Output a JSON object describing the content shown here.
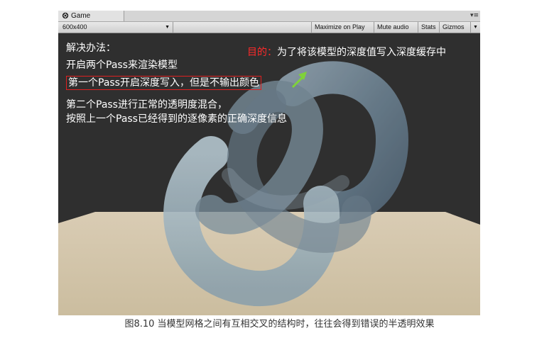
{
  "window": {
    "tab_title": "Game",
    "tab_icon": "unity-logo-icon",
    "menu_icon": "panel-menu-icon"
  },
  "toolbar": {
    "resolution": "600x400",
    "maximize_on_play": "Maximize on Play",
    "mute_audio": "Mute audio",
    "stats": "Stats",
    "gizmos": "Gizmos"
  },
  "annotations": {
    "line1": "解决办法：",
    "line2": "开启两个Pass来渲染模型",
    "line3": "第一个Pass开启深度写入，但是不输出颜色",
    "line4": "第二个Pass进行正常的透明度混合，",
    "line5": "按照上一个Pass已经得到的逐像素的正确深度信息",
    "goal_label": "目的：",
    "goal_text": "为了将该模型的深度值写入深度缓存中"
  },
  "colors": {
    "highlight_box": "#e02020",
    "goal_label": "#ff2a2a",
    "arrow": "#7fd23a",
    "floor": "#d8cbb3",
    "background": "#2f2f2f"
  },
  "caption": "图8.10 当模型网格之间有互相交叉的结构时，往往会得到错误的半透明效果"
}
